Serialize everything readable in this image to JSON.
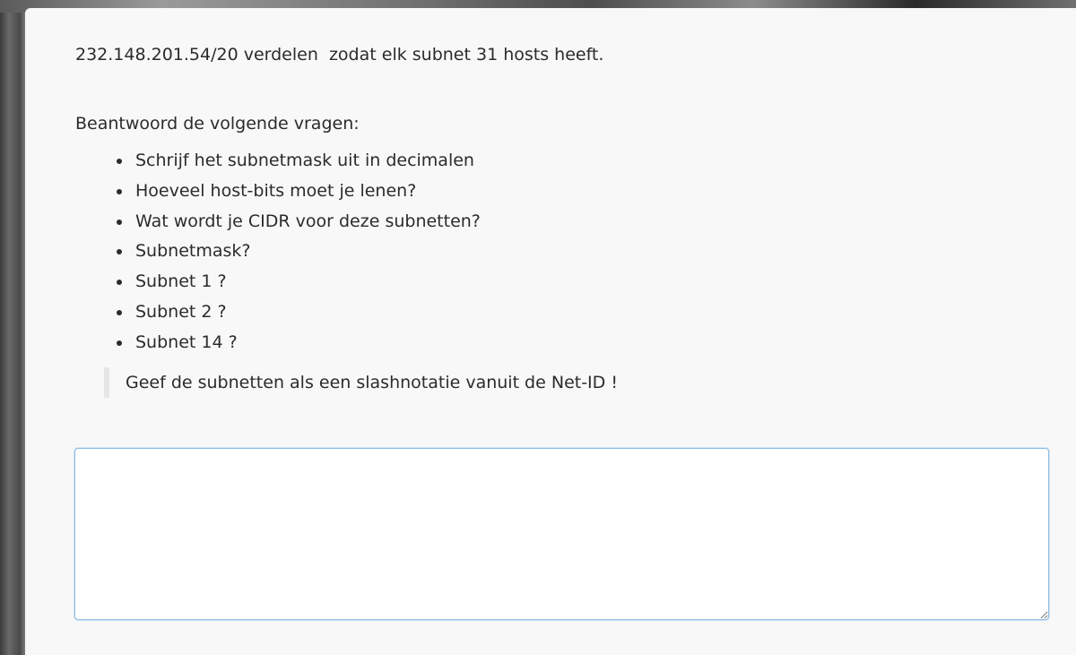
{
  "question": {
    "prompt": "232.148.201.54/20 verdelen  zodat elk subnet 31 hosts heeft.",
    "intro": "Beantwoord de volgende vragen:",
    "items": [
      {
        "label": "Schrijf het subnetmask uit in decimalen"
      },
      {
        "label": "Hoeveel host-bits moet je lenen?"
      },
      {
        "label": "Wat wordt je CIDR voor deze subnetten?"
      },
      {
        "label": "Subnetmask?"
      },
      {
        "label": "Subnet 1 ?"
      },
      {
        "label": "Subnet 2 ?"
      },
      {
        "label": "Subnet 14 ?"
      }
    ],
    "note": "Geef de subnetten als een slashnotatie vanuit de Net-ID !"
  },
  "answer": {
    "value": "",
    "placeholder": ""
  },
  "colors": {
    "text": "#2b2b2b",
    "card_background": "#f8f8f8",
    "textarea_border": "#8fbde3",
    "blockquote_border": "#e6e6e6"
  }
}
